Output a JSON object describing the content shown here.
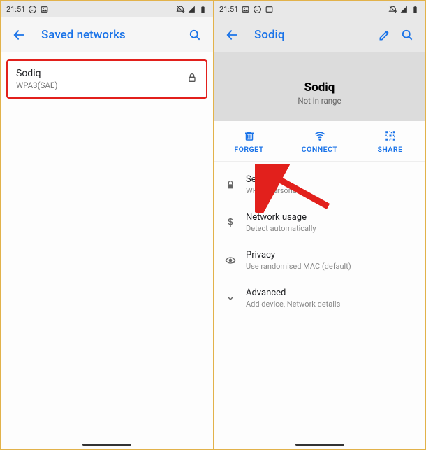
{
  "status": {
    "time": "21:51",
    "icons_left": [
      "whatsapp-icon",
      "image-icon"
    ],
    "icons_right": [
      "alarm-off-icon",
      "signal-icon",
      "battery-icon"
    ]
  },
  "colors": {
    "accent": "#1a73e8",
    "highlight": "#e2201c"
  },
  "left": {
    "title": "Saved networks",
    "network": {
      "name": "Sodiq",
      "sub": "WPA3(SAE)"
    }
  },
  "right": {
    "title": "Sodiq",
    "hero": {
      "name": "Sodiq",
      "sub": "Not in range"
    },
    "actions": {
      "forget": "FORGET",
      "connect": "CONNECT",
      "share": "SHARE"
    },
    "details": {
      "security": {
        "title": "Security",
        "sub": "WPA3-Personal"
      },
      "usage": {
        "title": "Network usage",
        "sub": "Detect automatically"
      },
      "privacy": {
        "title": "Privacy",
        "sub": "Use randomised MAC (default)"
      },
      "advanced": {
        "title": "Advanced",
        "sub": "Add device, Network details"
      }
    }
  }
}
